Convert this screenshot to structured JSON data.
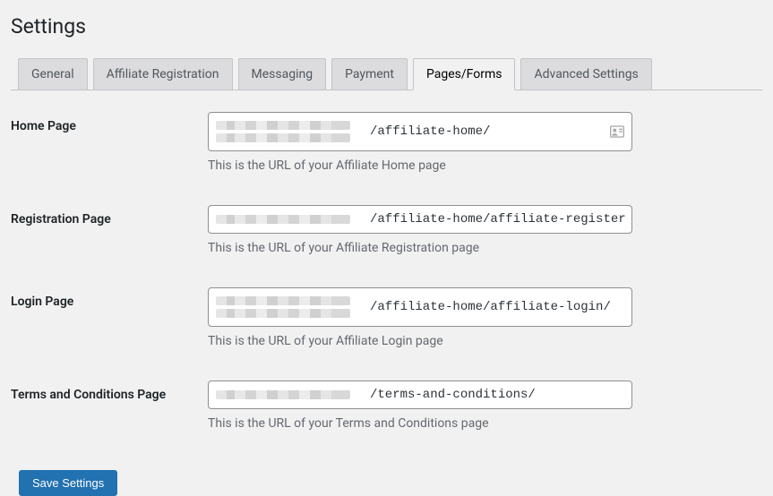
{
  "header": {
    "title": "Settings"
  },
  "tabs": [
    {
      "label": "General"
    },
    {
      "label": "Affiliate Registration"
    },
    {
      "label": "Messaging"
    },
    {
      "label": "Payment"
    },
    {
      "label": "Pages/Forms",
      "active": true
    },
    {
      "label": "Advanced Settings"
    }
  ],
  "fields": {
    "home": {
      "label": "Home Page",
      "value": "/affiliate-home/",
      "help": "This is the URL of your Affiliate Home page"
    },
    "registration": {
      "label": "Registration Page",
      "value": "/affiliate-home/affiliate-register/",
      "help": "This is the URL of your Affiliate Registration page"
    },
    "login": {
      "label": "Login Page",
      "value": "/affiliate-home/affiliate-login/",
      "help": "This is the URL of your Affiliate Login page"
    },
    "terms": {
      "label": "Terms and Conditions Page",
      "value": "/terms-and-conditions/",
      "help": "This is the URL of your Terms and Conditions page"
    }
  },
  "actions": {
    "save_label": "Save Settings"
  }
}
